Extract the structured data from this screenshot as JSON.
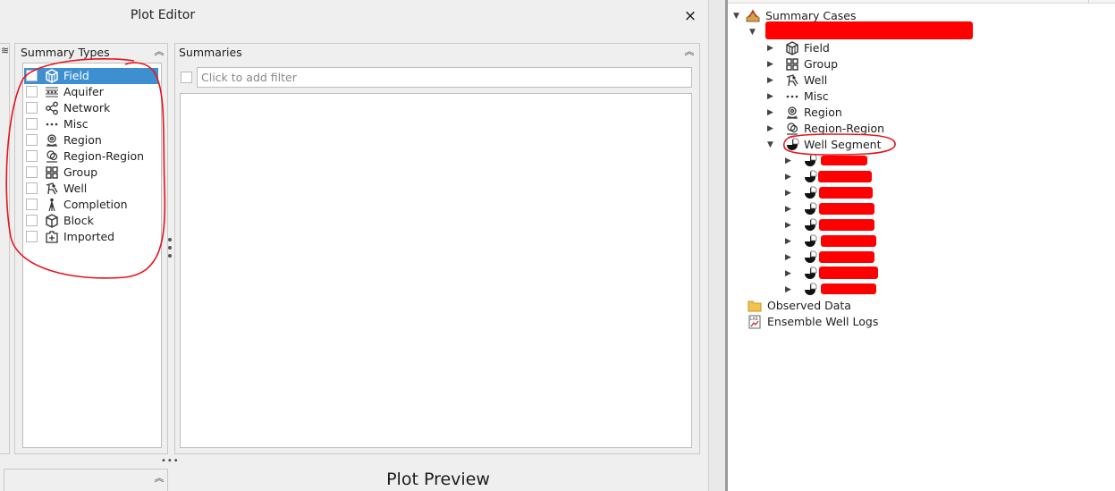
{
  "dialog": {
    "title": "Plot Editor",
    "close_label": "×",
    "left_strip_label": "ꟹ",
    "collapse_glyph": "≪",
    "summary_types": {
      "header": "Summary Types",
      "items": [
        {
          "label": "Field",
          "icon": "field-icon",
          "selected": true
        },
        {
          "label": "Aquifer",
          "icon": "aquifer-icon"
        },
        {
          "label": "Network",
          "icon": "network-icon"
        },
        {
          "label": "Misc",
          "icon": "misc-icon"
        },
        {
          "label": "Region",
          "icon": "region-icon"
        },
        {
          "label": "Region-Region",
          "icon": "region-region-icon"
        },
        {
          "label": "Group",
          "icon": "group-icon"
        },
        {
          "label": "Well",
          "icon": "well-icon"
        },
        {
          "label": "Completion",
          "icon": "completion-icon"
        },
        {
          "label": "Block",
          "icon": "block-icon"
        },
        {
          "label": "Imported",
          "icon": "imported-icon"
        }
      ]
    },
    "summaries": {
      "header": "Summaries",
      "filter_placeholder": "Click to add filter"
    },
    "preview_title": "Plot Preview",
    "splitter_glyph": "•••"
  },
  "tree": {
    "root": {
      "label": "Summary Cases",
      "icon": "summary-cases-icon"
    },
    "children": [
      {
        "label": "Field",
        "icon": "field-icon"
      },
      {
        "label": "Group",
        "icon": "group-icon"
      },
      {
        "label": "Well",
        "icon": "well-icon"
      },
      {
        "label": "Misc",
        "icon": "misc-icon"
      },
      {
        "label": "Region",
        "icon": "region-icon"
      },
      {
        "label": "Region-Region",
        "icon": "region-region-icon"
      },
      {
        "label": "Well Segment",
        "icon": "well-segment-icon",
        "expanded": true
      }
    ],
    "segment_item_count": 9,
    "observed_data": {
      "label": "Observed Data",
      "icon": "folder-icon"
    },
    "ensemble_logs": {
      "label": "Ensemble Well Logs",
      "icon": "las-icon"
    }
  },
  "colors": {
    "selection": "#3d8fd0",
    "redaction": "#ff0000",
    "annotation": "#e8141c"
  }
}
